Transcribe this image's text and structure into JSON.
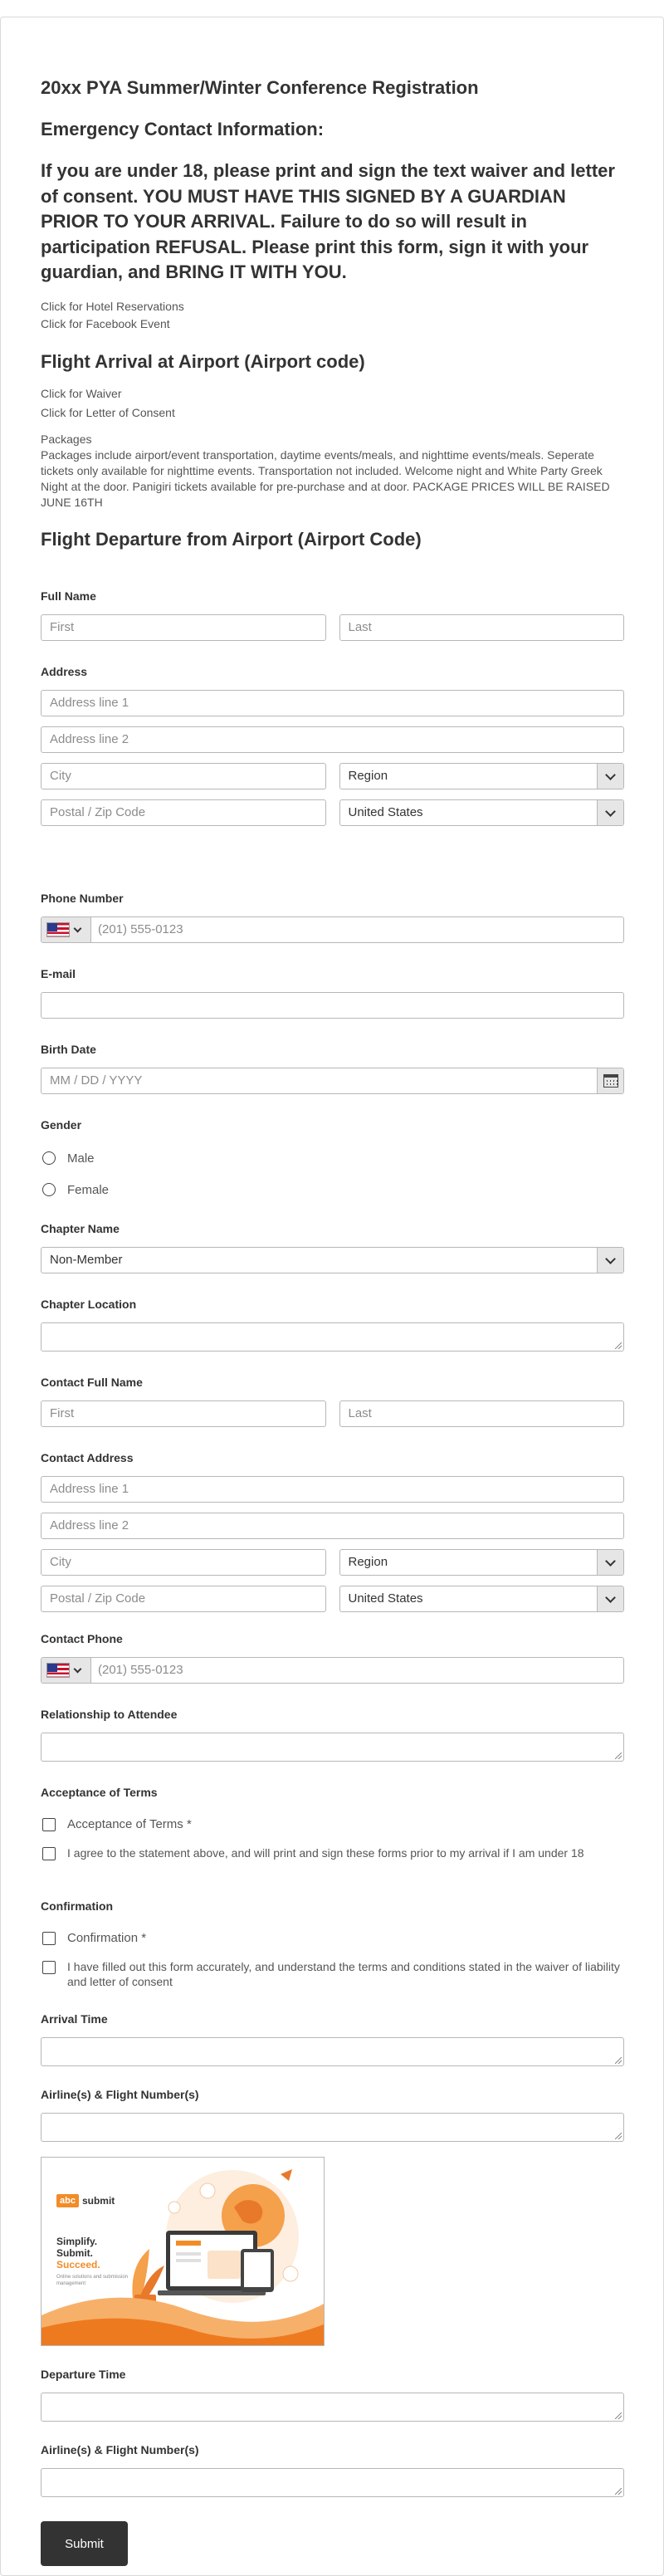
{
  "header": {
    "title": "20xx PYA Summer/Winter Conference Registration",
    "emergency_heading": "Emergency Contact Information:",
    "warning": "If you are under 18, please print and sign the text waiver and letter of consent. YOU MUST HAVE THIS SIGNED BY A GUARDIAN PRIOR TO YOUR ARRIVAL. Failure to do so will result in participation REFUSAL. Please print this form, sign it with your guardian, and BRING IT WITH YOU.",
    "hotel_link": "Click for Hotel Reservations",
    "facebook_link": "Click for Facebook Event",
    "arrival_heading": "Flight Arrival at Airport (Airport code)",
    "waiver_link": "Click for Waiver",
    "consent_link": "Click for Letter of Consent",
    "packages_title": "Packages",
    "packages_text": "Packages include airport/event transportation, daytime events/meals, and nighttime events/meals. Seperate tickets only available for nighttime events. Transportation not included. Welcome night and White Party Greek Night at the door. Panigiri tickets available for pre-purchase and at door. PACKAGE PRICES WILL BE RAISED JUNE 16TH",
    "departure_heading": "Flight Departure from Airport (Airport Code)"
  },
  "form": {
    "full_name": {
      "label": "Full Name",
      "first_placeholder": "First",
      "last_placeholder": "Last"
    },
    "address": {
      "label": "Address",
      "line1": "Address line 1",
      "line2": "Address line 2",
      "city": "City",
      "region": "Region",
      "postal": "Postal / Zip Code",
      "country": "United States"
    },
    "phone": {
      "label": "Phone Number",
      "placeholder": "(201) 555-0123"
    },
    "email": {
      "label": "E-mail"
    },
    "birth_date": {
      "label": "Birth Date",
      "placeholder": "MM / DD / YYYY"
    },
    "gender": {
      "label": "Gender",
      "options": [
        "Male",
        "Female"
      ]
    },
    "chapter_name": {
      "label": "Chapter Name",
      "value": "Non-Member"
    },
    "chapter_location": {
      "label": "Chapter Location"
    },
    "contact_full_name": {
      "label": "Contact Full Name",
      "first_placeholder": "First",
      "last_placeholder": "Last"
    },
    "contact_address": {
      "label": "Contact Address",
      "line1": "Address line 1",
      "line2": "Address line 2",
      "city": "City",
      "region": "Region",
      "postal": "Postal / Zip Code",
      "country": "United States"
    },
    "contact_phone": {
      "label": "Contact Phone",
      "placeholder": "(201) 555-0123"
    },
    "relationship": {
      "label": "Relationship to Attendee"
    },
    "acceptance": {
      "label": "Acceptance of Terms",
      "options": [
        "Acceptance of Terms *",
        "I agree to the statement above, and will print and sign these forms prior to my arrival if I am under 18"
      ]
    },
    "confirmation": {
      "label": "Confirmation",
      "options": [
        "Confirmation *",
        "I have filled out this form accurately, and understand the terms and conditions stated in the waiver of liability and letter of consent"
      ]
    },
    "arrival_time": {
      "label": "Arrival Time"
    },
    "arrival_flight": {
      "label": "Airline(s) & Flight Number(s)"
    },
    "promo": {
      "brand_abc": "abc",
      "brand_submit": "submit",
      "line1": "Simplify.",
      "line2": "Submit.",
      "line3": "Succeed.",
      "caption": "Online solutions and submission",
      "caption2": "management"
    },
    "departure_time": {
      "label": "Departure Time"
    },
    "departure_flight": {
      "label": "Airline(s) & Flight Number(s)"
    },
    "submit_label": "Submit"
  },
  "colors": {
    "accent": "#f28c28",
    "button": "#333333"
  }
}
